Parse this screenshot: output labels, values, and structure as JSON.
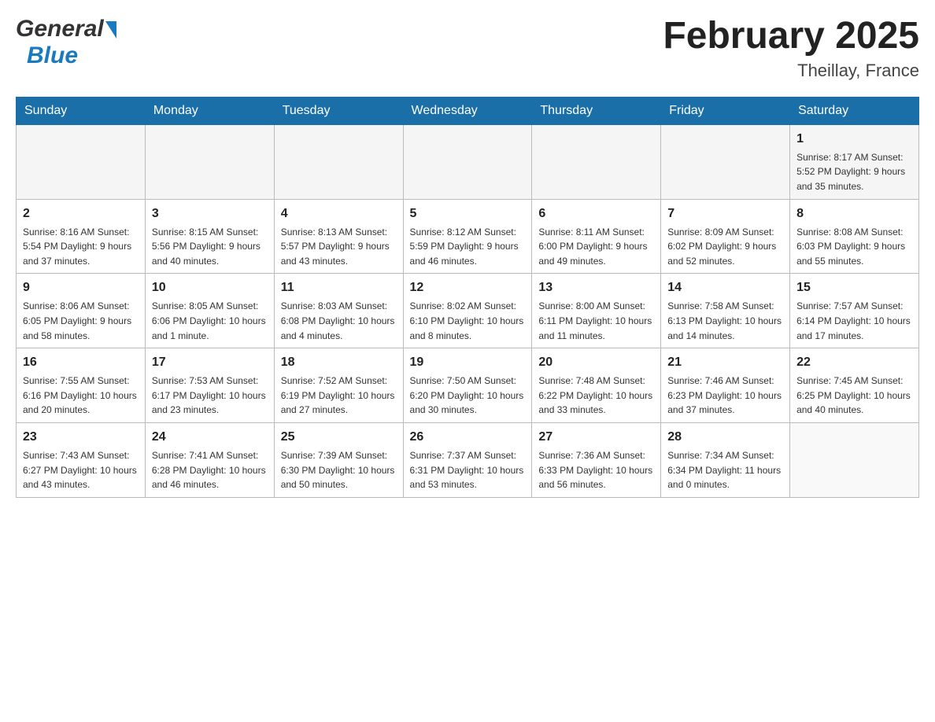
{
  "header": {
    "logo_general": "General",
    "logo_blue": "Blue",
    "month_year": "February 2025",
    "location": "Theillay, France"
  },
  "days_of_week": [
    "Sunday",
    "Monday",
    "Tuesday",
    "Wednesday",
    "Thursday",
    "Friday",
    "Saturday"
  ],
  "weeks": [
    [
      {
        "day": "",
        "info": ""
      },
      {
        "day": "",
        "info": ""
      },
      {
        "day": "",
        "info": ""
      },
      {
        "day": "",
        "info": ""
      },
      {
        "day": "",
        "info": ""
      },
      {
        "day": "",
        "info": ""
      },
      {
        "day": "1",
        "info": "Sunrise: 8:17 AM\nSunset: 5:52 PM\nDaylight: 9 hours\nand 35 minutes."
      }
    ],
    [
      {
        "day": "2",
        "info": "Sunrise: 8:16 AM\nSunset: 5:54 PM\nDaylight: 9 hours\nand 37 minutes."
      },
      {
        "day": "3",
        "info": "Sunrise: 8:15 AM\nSunset: 5:56 PM\nDaylight: 9 hours\nand 40 minutes."
      },
      {
        "day": "4",
        "info": "Sunrise: 8:13 AM\nSunset: 5:57 PM\nDaylight: 9 hours\nand 43 minutes."
      },
      {
        "day": "5",
        "info": "Sunrise: 8:12 AM\nSunset: 5:59 PM\nDaylight: 9 hours\nand 46 minutes."
      },
      {
        "day": "6",
        "info": "Sunrise: 8:11 AM\nSunset: 6:00 PM\nDaylight: 9 hours\nand 49 minutes."
      },
      {
        "day": "7",
        "info": "Sunrise: 8:09 AM\nSunset: 6:02 PM\nDaylight: 9 hours\nand 52 minutes."
      },
      {
        "day": "8",
        "info": "Sunrise: 8:08 AM\nSunset: 6:03 PM\nDaylight: 9 hours\nand 55 minutes."
      }
    ],
    [
      {
        "day": "9",
        "info": "Sunrise: 8:06 AM\nSunset: 6:05 PM\nDaylight: 9 hours\nand 58 minutes."
      },
      {
        "day": "10",
        "info": "Sunrise: 8:05 AM\nSunset: 6:06 PM\nDaylight: 10 hours\nand 1 minute."
      },
      {
        "day": "11",
        "info": "Sunrise: 8:03 AM\nSunset: 6:08 PM\nDaylight: 10 hours\nand 4 minutes."
      },
      {
        "day": "12",
        "info": "Sunrise: 8:02 AM\nSunset: 6:10 PM\nDaylight: 10 hours\nand 8 minutes."
      },
      {
        "day": "13",
        "info": "Sunrise: 8:00 AM\nSunset: 6:11 PM\nDaylight: 10 hours\nand 11 minutes."
      },
      {
        "day": "14",
        "info": "Sunrise: 7:58 AM\nSunset: 6:13 PM\nDaylight: 10 hours\nand 14 minutes."
      },
      {
        "day": "15",
        "info": "Sunrise: 7:57 AM\nSunset: 6:14 PM\nDaylight: 10 hours\nand 17 minutes."
      }
    ],
    [
      {
        "day": "16",
        "info": "Sunrise: 7:55 AM\nSunset: 6:16 PM\nDaylight: 10 hours\nand 20 minutes."
      },
      {
        "day": "17",
        "info": "Sunrise: 7:53 AM\nSunset: 6:17 PM\nDaylight: 10 hours\nand 23 minutes."
      },
      {
        "day": "18",
        "info": "Sunrise: 7:52 AM\nSunset: 6:19 PM\nDaylight: 10 hours\nand 27 minutes."
      },
      {
        "day": "19",
        "info": "Sunrise: 7:50 AM\nSunset: 6:20 PM\nDaylight: 10 hours\nand 30 minutes."
      },
      {
        "day": "20",
        "info": "Sunrise: 7:48 AM\nSunset: 6:22 PM\nDaylight: 10 hours\nand 33 minutes."
      },
      {
        "day": "21",
        "info": "Sunrise: 7:46 AM\nSunset: 6:23 PM\nDaylight: 10 hours\nand 37 minutes."
      },
      {
        "day": "22",
        "info": "Sunrise: 7:45 AM\nSunset: 6:25 PM\nDaylight: 10 hours\nand 40 minutes."
      }
    ],
    [
      {
        "day": "23",
        "info": "Sunrise: 7:43 AM\nSunset: 6:27 PM\nDaylight: 10 hours\nand 43 minutes."
      },
      {
        "day": "24",
        "info": "Sunrise: 7:41 AM\nSunset: 6:28 PM\nDaylight: 10 hours\nand 46 minutes."
      },
      {
        "day": "25",
        "info": "Sunrise: 7:39 AM\nSunset: 6:30 PM\nDaylight: 10 hours\nand 50 minutes."
      },
      {
        "day": "26",
        "info": "Sunrise: 7:37 AM\nSunset: 6:31 PM\nDaylight: 10 hours\nand 53 minutes."
      },
      {
        "day": "27",
        "info": "Sunrise: 7:36 AM\nSunset: 6:33 PM\nDaylight: 10 hours\nand 56 minutes."
      },
      {
        "day": "28",
        "info": "Sunrise: 7:34 AM\nSunset: 6:34 PM\nDaylight: 11 hours\nand 0 minutes."
      },
      {
        "day": "",
        "info": ""
      }
    ]
  ]
}
